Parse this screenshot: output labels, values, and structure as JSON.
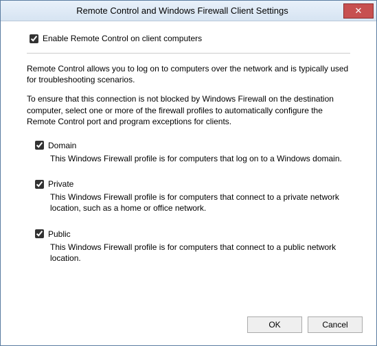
{
  "window": {
    "title": "Remote Control and Windows Firewall Client Settings"
  },
  "enable": {
    "label": "Enable Remote Control on client computers",
    "checked": true
  },
  "intro1": "Remote Control allows you to log on to computers over the network and is typically used for troubleshooting scenarios.",
  "intro2": "To ensure that this connection is not blocked by Windows Firewall on the destination computer, select one or more of the firewall profiles to automatically configure the Remote Control port and program exceptions for clients.",
  "profiles": {
    "domain": {
      "label": "Domain",
      "checked": true,
      "desc": "This Windows Firewall profile is for computers that log on to a Windows domain."
    },
    "private": {
      "label": "Private",
      "checked": true,
      "desc": "This Windows Firewall profile is for computers that connect to a private network location, such as a home or office network."
    },
    "public": {
      "label": "Public",
      "checked": true,
      "desc": "This Windows Firewall profile is for computers that connect to a public network location."
    }
  },
  "buttons": {
    "ok": "OK",
    "cancel": "Cancel"
  }
}
